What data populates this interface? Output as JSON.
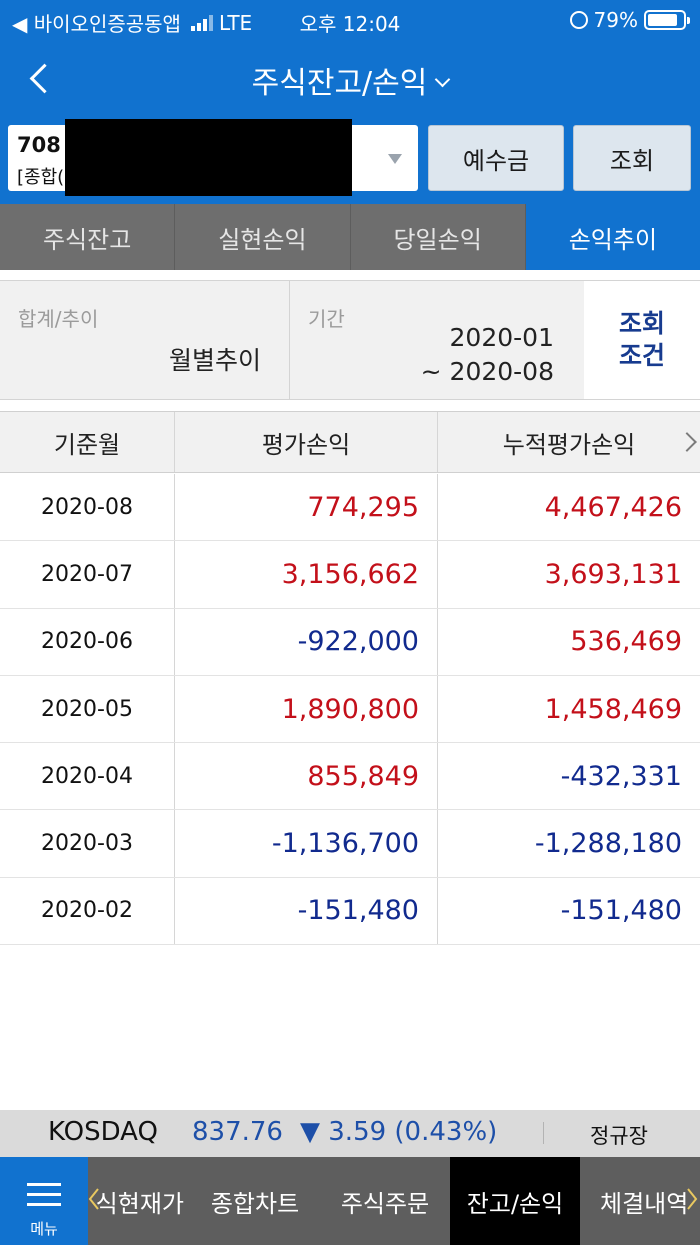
{
  "status_bar": {
    "back_app": "◀ 바이오인증공동앱",
    "network": "LTE",
    "time": "오후 12:04",
    "battery": "79%"
  },
  "header": {
    "title": "주식잔고/손익"
  },
  "account": {
    "number_prefix": "708",
    "type_prefix": "[종합(",
    "deposit_label": "예수금",
    "query_label": "조회"
  },
  "tabs": [
    {
      "label": "주식잔고"
    },
    {
      "label": "실현손익"
    },
    {
      "label": "당일손익"
    },
    {
      "label": "손익추이"
    }
  ],
  "active_tab": "손익추이",
  "conditions": {
    "sum_label": "합계/추이",
    "sum_value": "월별추이",
    "period_label": "기간",
    "period_from": "2020-01",
    "period_to": "~ 2020-08",
    "button_line1": "조회",
    "button_line2": "조건"
  },
  "table": {
    "headers": [
      "기준월",
      "평가손익",
      "누적평가손익"
    ],
    "rows": [
      {
        "month": "2020-08",
        "pnl": "774,295",
        "cum": "4,467,426"
      },
      {
        "month": "2020-07",
        "pnl": "3,156,662",
        "cum": "3,693,131"
      },
      {
        "month": "2020-06",
        "pnl": "-922,000",
        "cum": "536,469"
      },
      {
        "month": "2020-05",
        "pnl": "1,890,800",
        "cum": "1,458,469"
      },
      {
        "month": "2020-04",
        "pnl": "855,849",
        "cum": "-432,331"
      },
      {
        "month": "2020-03",
        "pnl": "-1,136,700",
        "cum": "-1,288,180"
      },
      {
        "month": "2020-02",
        "pnl": "-151,480",
        "cum": "-151,480"
      }
    ]
  },
  "ticker": {
    "name": "KOSDAQ",
    "value": "837.76",
    "change": "▼ 3.59 (0.43%)",
    "session": "정규장"
  },
  "bottom_nav": {
    "menu_label": "메뉴",
    "items": [
      {
        "label": "식현재가"
      },
      {
        "label": "종합차트"
      },
      {
        "label": "주식주문"
      },
      {
        "label": "잔고/손익"
      },
      {
        "label": "체결내역"
      }
    ],
    "active": "잔고/손익"
  },
  "colors": {
    "brand_blue": "#1172cf",
    "positive": "#c3101a",
    "negative": "#112a8e"
  }
}
